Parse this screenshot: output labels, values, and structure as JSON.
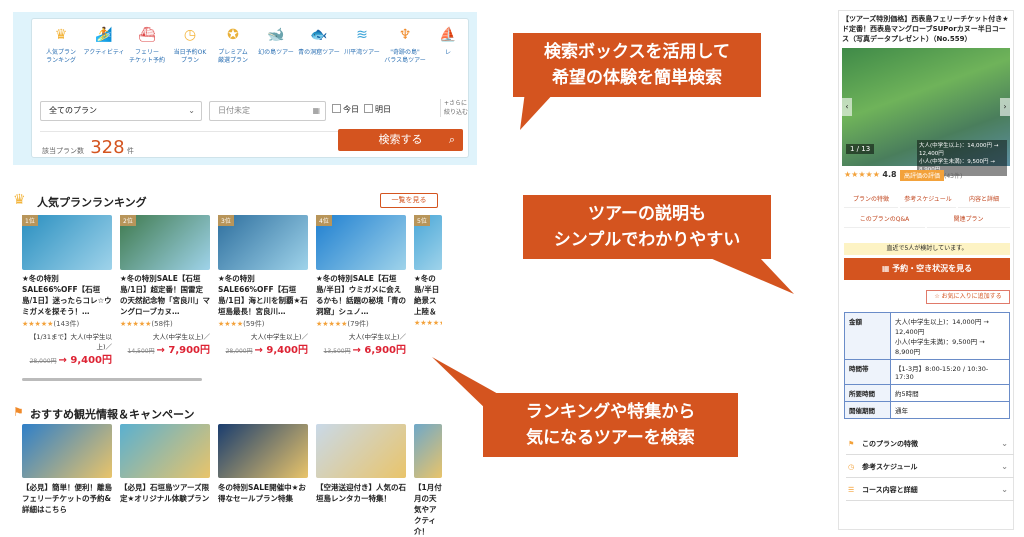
{
  "search": {
    "categories": [
      {
        "label": "人気プラン\nランキング",
        "icon": "crown-icon",
        "color": "#f3b43b"
      },
      {
        "label": "アクティビティ",
        "icon": "surfer-icon",
        "color": "#3aa3d8"
      },
      {
        "label": "フェリー\nチケット予約",
        "icon": "ferry-icon",
        "color": "#d44"
      },
      {
        "label": "当日予約OK\nプラン",
        "icon": "clock-icon",
        "color": "#f3b43b"
      },
      {
        "label": "プレミアム\n厳選プラン",
        "icon": "medal-icon",
        "color": "#e9b13a"
      },
      {
        "label": "幻の島ツアー",
        "icon": "whale-icon",
        "color": "#3aa3d8"
      },
      {
        "label": "青の洞窟ツアー",
        "icon": "fish-icon",
        "color": "#3aa3d8"
      },
      {
        "label": "川平湾ツアー",
        "icon": "wave-icon",
        "color": "#3aa3d8"
      },
      {
        "label": "\"奇跡の島\"\nバラス島ツアー",
        "icon": "palm-icon",
        "color": "#f08a2a"
      },
      {
        "label": "レ",
        "icon": "boat-icon",
        "color": "#3aa3d8"
      }
    ],
    "plan_select": "全てのプラン",
    "date_placeholder": "日付未定",
    "today": "今日",
    "tomorrow": "明日",
    "more_filter": "+さらに\n絞り込む",
    "count_label": "該当プラン数",
    "count": "328",
    "count_unit": "件",
    "search_button": "検索する"
  },
  "callouts": {
    "top": "検索ボックスを活用して\n希望の体験を簡単検索",
    "mid": "ツアーの説明も\nシンプルでわかりやすい",
    "bottom": "ランキングや特集から\n気になるツアーを検索"
  },
  "ranking": {
    "title": "人気プランランキング",
    "see_all": "一覧を見る",
    "items": [
      {
        "rank": "1位",
        "title": "★冬の特別SALE66%OFF【石垣島/1日】迷ったらコレ☆ウミガメを探そう！…",
        "stars": "★★★★★",
        "reviews": "(143件)",
        "note": "【1/31まで】大人(中学生以上)／",
        "old": "28,000円",
        "price": "→ 9,400円",
        "color": "#2a8fc0"
      },
      {
        "rank": "2位",
        "title": "★冬の特別SALE【石垣島/1日】超定番！国雷定の天然記念物「宮良川」マングローブカヌ…",
        "stars": "★★★★★",
        "reviews": "(58件)",
        "note": "大人(中学生以上)／",
        "old": "14,500円",
        "price": "→ 7,900円",
        "color": "#3f7a4e"
      },
      {
        "rank": "3位",
        "title": "★冬の特別SALE66%OFF【石垣島/1日】海と川を制覇★石垣島最長！宮良川…",
        "stars": "★★★★",
        "reviews": "(59件)",
        "note": "大人(中学生以上)／",
        "old": "28,000円",
        "price": "→ 9,400円",
        "color": "#2e6f9e"
      },
      {
        "rank": "4位",
        "title": "★冬の特別SALE【石垣島/半日】ウミガメに会えるかも！話題の秘境「青の洞窟」シュノ…",
        "stars": "★★★★★",
        "reviews": "(79件)",
        "note": "大人(中学生以上)／",
        "old": "13,500円",
        "price": "→ 6,900円",
        "color": "#1f7fd0"
      },
      {
        "rank": "5位",
        "title": "★冬の島/半日絶景ス上陸＆",
        "stars": "★★★★★",
        "reviews": "",
        "note": "",
        "old": "",
        "price": "",
        "color": "#4aa7d8"
      }
    ]
  },
  "specials": {
    "title": "おすすめ観光情報＆キャンペーン",
    "items": [
      {
        "title": "【必見】簡単！便利！離島フェリーチケットの予約&詳細はこちら",
        "color": "#2f7fc8"
      },
      {
        "title": "【必見】石垣島ツアーズ限定★オリジナル体験プラン",
        "color": "#5ab0d0"
      },
      {
        "title": "冬の特別SALE開催中★お得なセールプラン特集",
        "color": "#1a3d6e"
      },
      {
        "title": "【空港送迎付き】人気の石垣島レンタカー特集！",
        "color": "#c9d9e8"
      },
      {
        "title": "【1月付月の天気やアクティ介！",
        "color": "#6fa8c8"
      }
    ]
  },
  "detail": {
    "title": "【ツアーズ特別価格】西表島フェリーチケット付き★ド定番！西表島マングローブSUPorカヌー半日コース（写真データプレゼント）（No.559）",
    "photo_counter": "1 / 13",
    "photo_price_adult": "大人(中学生以上)：14,000円 → 12,400円",
    "photo_price_child": "小人(中学生未満)：9,500円 → 8,900円",
    "rating": "4.8",
    "rating_badge": "高評価の評価",
    "rating_count": "(43件)",
    "tabs": [
      "プランの特徴",
      "参考スケジュール",
      "内容と詳細",
      "このプランのQ&A",
      "関連プラン"
    ],
    "viewers": "直近で5人が検討しています。",
    "book_button": "予約・空き状況を見る",
    "fav_button": "お気に入りに追加する",
    "table": [
      {
        "k": "金額",
        "v": "大人(中学生以上)：14,000円 → 12,400円\n小人(中学生未満)：9,500円 → 8,900円"
      },
      {
        "k": "時間帯",
        "v": "【1-3月】8:00-15:20 / 10:30-17:30"
      },
      {
        "k": "所要時間",
        "v": "約5時間"
      },
      {
        "k": "開催期間",
        "v": "通年"
      }
    ],
    "accordion": [
      "このプランの特徴",
      "参考スケジュール",
      "コース内容と詳細"
    ]
  }
}
